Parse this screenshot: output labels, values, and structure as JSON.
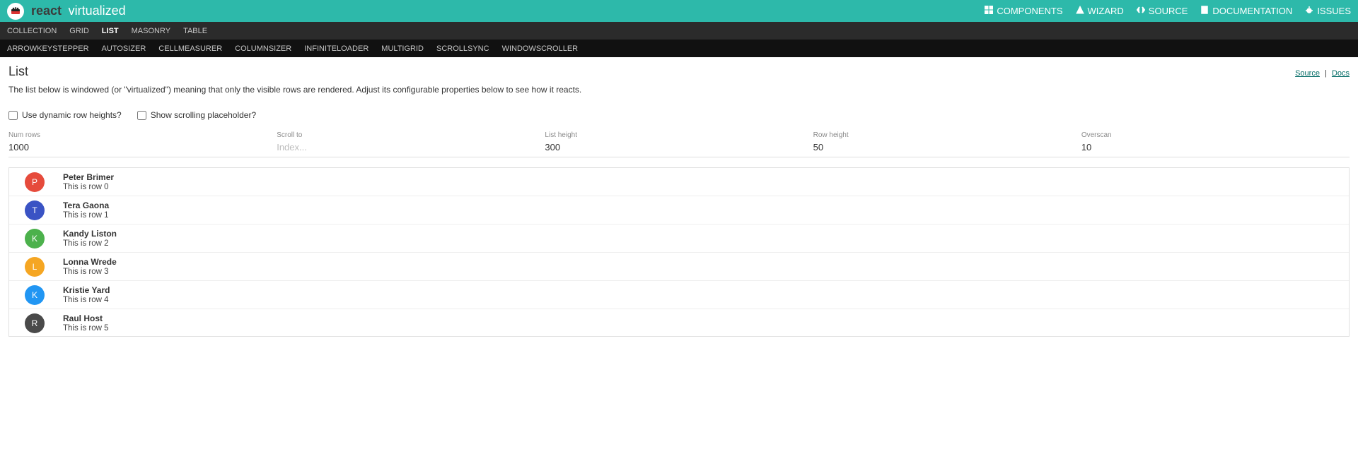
{
  "brand": {
    "react": "react",
    "virtualized": "virtualized"
  },
  "topnav": [
    {
      "label": "COMPONENTS",
      "icon": "grid"
    },
    {
      "label": "WIZARD",
      "icon": "tri"
    },
    {
      "label": "SOURCE",
      "icon": "code"
    },
    {
      "label": "DOCUMENTATION",
      "icon": "doc"
    },
    {
      "label": "ISSUES",
      "icon": "bug"
    }
  ],
  "subnav1": [
    {
      "label": "COLLECTION",
      "active": false
    },
    {
      "label": "GRID",
      "active": false
    },
    {
      "label": "LIST",
      "active": true
    },
    {
      "label": "MASONRY",
      "active": false
    },
    {
      "label": "TABLE",
      "active": false
    }
  ],
  "subnav2": [
    "ARROWKEYSTEPPER",
    "AUTOSIZER",
    "CELLMEASURER",
    "COLUMNSIZER",
    "INFINITELOADER",
    "MULTIGRID",
    "SCROLLSYNC",
    "WINDOWSCROLLER"
  ],
  "page": {
    "title": "List",
    "source": "Source",
    "docs": "Docs",
    "desc": "The list below is windowed (or \"virtualized\") meaning that only the visible rows are rendered. Adjust its configurable properties below to see how it reacts."
  },
  "checks": {
    "dynamic": "Use dynamic row heights?",
    "placeholder": "Show scrolling placeholder?"
  },
  "fields": {
    "numRows": {
      "label": "Num rows",
      "value": "1000"
    },
    "scrollTo": {
      "label": "Scroll to",
      "value": "",
      "placeholder": "Index..."
    },
    "listHeight": {
      "label": "List height",
      "value": "300"
    },
    "rowHeight": {
      "label": "Row height",
      "value": "50"
    },
    "overscan": {
      "label": "Overscan",
      "value": "10"
    }
  },
  "rows": [
    {
      "initial": "P",
      "name": "Peter Brimer",
      "sub": "This is row 0",
      "color": "#e64b3c"
    },
    {
      "initial": "T",
      "name": "Tera Gaona",
      "sub": "This is row 1",
      "color": "#3a53c4"
    },
    {
      "initial": "K",
      "name": "Kandy Liston",
      "sub": "This is row 2",
      "color": "#4cb14c"
    },
    {
      "initial": "L",
      "name": "Lonna Wrede",
      "sub": "This is row 3",
      "color": "#f5a623"
    },
    {
      "initial": "K",
      "name": "Kristie Yard",
      "sub": "This is row 4",
      "color": "#2196f3"
    },
    {
      "initial": "R",
      "name": "Raul Host",
      "sub": "This is row 5",
      "color": "#4a4a4a"
    }
  ]
}
